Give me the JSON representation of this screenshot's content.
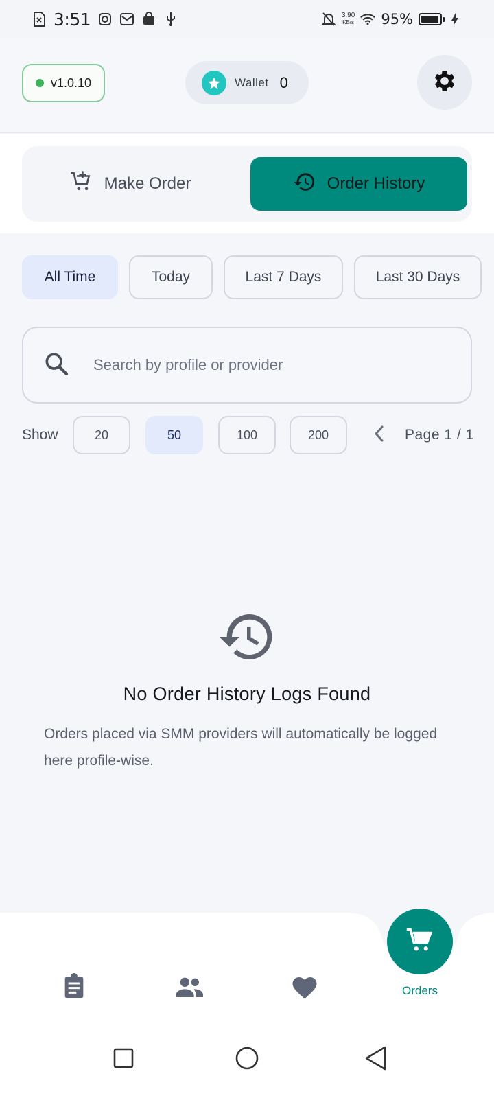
{
  "status_bar": {
    "time": "3:51",
    "net_speed_value": "3.90",
    "net_speed_unit": "KB/s",
    "battery_percent": "95%",
    "battery_level": 0.95
  },
  "header": {
    "version": "v1.0.10",
    "wallet_label": "Wallet",
    "wallet_value": "0"
  },
  "mode_tabs": {
    "make_order": "Make Order",
    "order_history": "Order History",
    "active": "order_history"
  },
  "filters": {
    "items": [
      "All Time",
      "Today",
      "Last 7 Days",
      "Last 30 Days"
    ],
    "active": "All Time"
  },
  "search": {
    "placeholder": "Search by profile or provider",
    "value": ""
  },
  "pagination": {
    "show_label": "Show",
    "sizes": [
      "20",
      "50",
      "100",
      "200"
    ],
    "active_size": "50",
    "page_label": "Page 1 / 1"
  },
  "empty_state": {
    "title": "No Order History Logs Found",
    "description": "Orders placed via SMM providers will automatically be logged here profile-wise."
  },
  "bottom_nav": {
    "items": [
      "clipboard-icon",
      "users-icon",
      "heart-icon",
      "cart-icon"
    ],
    "active_label": "Orders"
  },
  "colors": {
    "accent": "#00897d",
    "active_chip": "#e2eafc",
    "online": "#3db35a",
    "wallet_star": "#20c6bf"
  }
}
